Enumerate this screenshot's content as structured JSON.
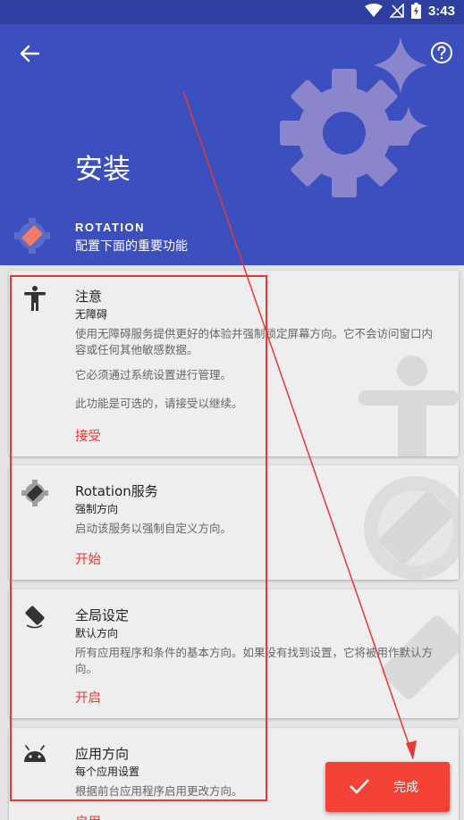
{
  "status_bar": {
    "time": "3:43"
  },
  "header": {
    "title": "安装",
    "app_name": "ROTATION",
    "app_subtitle": "配置下面的重要功能"
  },
  "cards": [
    {
      "title": "注意",
      "subtitle": "无障碍",
      "desc1": "使用无障碍服务提供更好的体验并强制锁定屏幕方向。它不会访问窗口内容或任何其他敏感数据。",
      "desc2": "它必须通过系统设置进行管理。",
      "desc3": "此功能是可选的，请接受以继续。",
      "action": "接受"
    },
    {
      "title": "Rotation服务",
      "subtitle": "强制方向",
      "desc1": "启动该服务以强制自定义方向。",
      "action": "开始"
    },
    {
      "title": "全局设定",
      "subtitle": "默认方向",
      "desc1": "所有应用程序和条件的基本方向。如果没有找到设置，它将被用作默认方向。",
      "action": "开启"
    },
    {
      "title": "应用方向",
      "subtitle": "每个应用设置",
      "desc1": "根据前台应用程序启用更改方向。",
      "action": "启用"
    }
  ],
  "fab": {
    "label": "完成"
  },
  "colors": {
    "header": "#3c4fbe",
    "status_bar": "#2f3fa0",
    "accent": "#e53935",
    "fab": "#f44336",
    "card": "#eeeeee"
  }
}
